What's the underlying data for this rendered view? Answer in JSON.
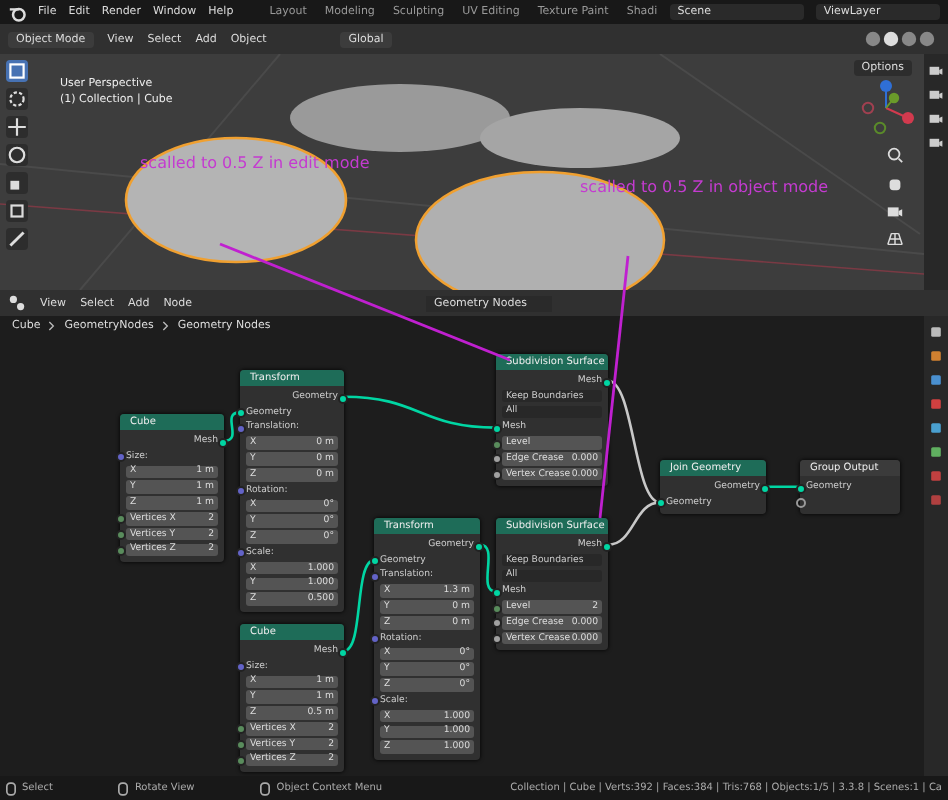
{
  "menu": [
    "File",
    "Edit",
    "Render",
    "Window",
    "Help"
  ],
  "workspace_tabs": [
    {
      "label": "Layout",
      "selected": false
    },
    {
      "label": "Modeling",
      "selected": false
    },
    {
      "label": "Sculpting",
      "selected": false
    },
    {
      "label": "UV Editing",
      "selected": false
    },
    {
      "label": "Texture Paint",
      "selected": false
    },
    {
      "label": "Shadi",
      "selected": false
    }
  ],
  "scene": "Scene",
  "view_layer": "ViewLayer",
  "viewport": {
    "mode": "Object Mode",
    "menu": [
      "View",
      "Select",
      "Add",
      "Object"
    ],
    "orientation": "Global",
    "view_name": "User Perspective",
    "collection": "(1) Collection | Cube",
    "options": "Options",
    "annotations": [
      "scalled to 0.5 Z in edit mode",
      "scalled to 0.5 Z in object mode"
    ]
  },
  "node_editor": {
    "menu": [
      "View",
      "Select",
      "Add",
      "Node"
    ],
    "tree_name": "Geometry Nodes",
    "breadcrumbs": [
      "Cube",
      "GeometryNodes",
      "Geometry Nodes"
    ],
    "nodes": [
      {
        "title": "Cube",
        "kind": "geometry",
        "rows": [
          {
            "kind": "output",
            "label": "Mesh",
            "color": "#00d6a3"
          },
          {
            "kind": "input",
            "label": "Size:",
            "color": "#6363c7"
          },
          {
            "kind": "field",
            "label": "X",
            "value": "1 m"
          },
          {
            "kind": "field",
            "label": "Y",
            "value": "1 m"
          },
          {
            "kind": "field",
            "label": "Z",
            "value": "1 m"
          },
          {
            "kind": "field",
            "label": "Vertices X",
            "value": "2",
            "color": "#598c5c"
          },
          {
            "kind": "field",
            "label": "Vertices Y",
            "value": "2",
            "color": "#598c5c"
          },
          {
            "kind": "field",
            "label": "Vertices Z",
            "value": "2",
            "color": "#598c5c"
          }
        ]
      },
      {
        "title": "Transform",
        "kind": "geometry",
        "rows": [
          {
            "kind": "output",
            "label": "Geometry",
            "color": "#00d6a3"
          },
          {
            "kind": "input",
            "label": "Geometry",
            "color": "#00d6a3"
          },
          {
            "kind": "input",
            "label": "Translation:",
            "color": "#6363c7"
          },
          {
            "kind": "field",
            "label": "X",
            "value": "0 m"
          },
          {
            "kind": "field",
            "label": "Y",
            "value": "0 m"
          },
          {
            "kind": "field",
            "label": "Z",
            "value": "0 m"
          },
          {
            "kind": "input",
            "label": "Rotation:",
            "color": "#6363c7"
          },
          {
            "kind": "field",
            "label": "X",
            "value": "0°"
          },
          {
            "kind": "field",
            "label": "Y",
            "value": "0°"
          },
          {
            "kind": "field",
            "label": "Z",
            "value": "0°"
          },
          {
            "kind": "input",
            "label": "Scale:",
            "color": "#6363c7"
          },
          {
            "kind": "field",
            "label": "X",
            "value": "1.000"
          },
          {
            "kind": "field",
            "label": "Y",
            "value": "1.000"
          },
          {
            "kind": "field",
            "label": "Z",
            "value": "0.500"
          }
        ]
      },
      {
        "title": "Subdivision Surface",
        "kind": "geometry",
        "rows": [
          {
            "kind": "output",
            "label": "Mesh",
            "color": "#00d6a3"
          },
          {
            "kind": "dropdown",
            "label": "Keep Boundaries"
          },
          {
            "kind": "dropdown",
            "label": "All"
          },
          {
            "kind": "input",
            "label": "Mesh",
            "color": "#00d6a3"
          },
          {
            "kind": "field",
            "label": "Level",
            "color": "#598c5c"
          },
          {
            "kind": "field",
            "label": "Edge Crease",
            "value": "0.000",
            "color": "#a1a1a1"
          },
          {
            "kind": "field",
            "label": "Vertex Crease",
            "value": "0.000",
            "color": "#a1a1a1"
          }
        ]
      },
      {
        "title": "Join Geometry",
        "kind": "geometry",
        "rows": [
          {
            "kind": "output",
            "label": "Geometry",
            "color": "#00d6a3"
          },
          {
            "kind": "input",
            "label": "Geometry",
            "color": "#00d6a3"
          }
        ]
      },
      {
        "title": "Group Output",
        "kind": "output",
        "rows": [
          {
            "kind": "input",
            "label": "Geometry",
            "color": "#00d6a3"
          },
          {
            "kind": "empty"
          }
        ]
      },
      {
        "title": "Transform",
        "kind": "geometry",
        "rows": [
          {
            "kind": "output",
            "label": "Geometry",
            "color": "#00d6a3"
          },
          {
            "kind": "input",
            "label": "Geometry",
            "color": "#00d6a3"
          },
          {
            "kind": "input",
            "label": "Translation:",
            "color": "#6363c7"
          },
          {
            "kind": "field",
            "label": "X",
            "value": "1.3 m"
          },
          {
            "kind": "field",
            "label": "Y",
            "value": "0 m"
          },
          {
            "kind": "field",
            "label": "Z",
            "value": "0 m"
          },
          {
            "kind": "input",
            "label": "Rotation:",
            "color": "#6363c7"
          },
          {
            "kind": "field",
            "label": "X",
            "value": "0°"
          },
          {
            "kind": "field",
            "label": "Y",
            "value": "0°"
          },
          {
            "kind": "field",
            "label": "Z",
            "value": "0°"
          },
          {
            "kind": "input",
            "label": "Scale:",
            "color": "#6363c7"
          },
          {
            "kind": "field",
            "label": "X",
            "value": "1.000"
          },
          {
            "kind": "field",
            "label": "Y",
            "value": "1.000"
          },
          {
            "kind": "field",
            "label": "Z",
            "value": "1.000"
          }
        ]
      },
      {
        "title": "Subdivision Surface",
        "kind": "geometry",
        "rows": [
          {
            "kind": "output",
            "label": "Mesh",
            "color": "#00d6a3"
          },
          {
            "kind": "dropdown",
            "label": "Keep Boundaries"
          },
          {
            "kind": "dropdown",
            "label": "All"
          },
          {
            "kind": "input",
            "label": "Mesh",
            "color": "#00d6a3"
          },
          {
            "kind": "field",
            "label": "Level",
            "value": "2",
            "color": "#598c5c"
          },
          {
            "kind": "field",
            "label": "Edge Crease",
            "value": "0.000",
            "color": "#a1a1a1"
          },
          {
            "kind": "field",
            "label": "Vertex Crease",
            "value": "0.000",
            "color": "#a1a1a1"
          }
        ]
      },
      {
        "title": "Cube",
        "kind": "geometry",
        "rows": [
          {
            "kind": "output",
            "label": "Mesh",
            "color": "#00d6a3"
          },
          {
            "kind": "input",
            "label": "Size:",
            "color": "#6363c7"
          },
          {
            "kind": "field",
            "label": "X",
            "value": "1 m"
          },
          {
            "kind": "field",
            "label": "Y",
            "value": "1 m"
          },
          {
            "kind": "field",
            "label": "Z",
            "value": "0.5 m"
          },
          {
            "kind": "field",
            "label": "Vertices X",
            "value": "2",
            "color": "#598c5c"
          },
          {
            "kind": "field",
            "label": "Vertices Y",
            "value": "2",
            "color": "#598c5c"
          },
          {
            "kind": "field",
            "label": "Vertices Z",
            "value": "2",
            "color": "#598c5c"
          }
        ]
      }
    ]
  },
  "status_bar": {
    "hints": [
      "Select",
      "Rotate View",
      "Object Context Menu"
    ],
    "stats": "Collection | Cube | Verts:392 | Faces:384 | Tris:768 | Objects:1/5 | 3.3.8 | Scenes:1 | Ca"
  }
}
